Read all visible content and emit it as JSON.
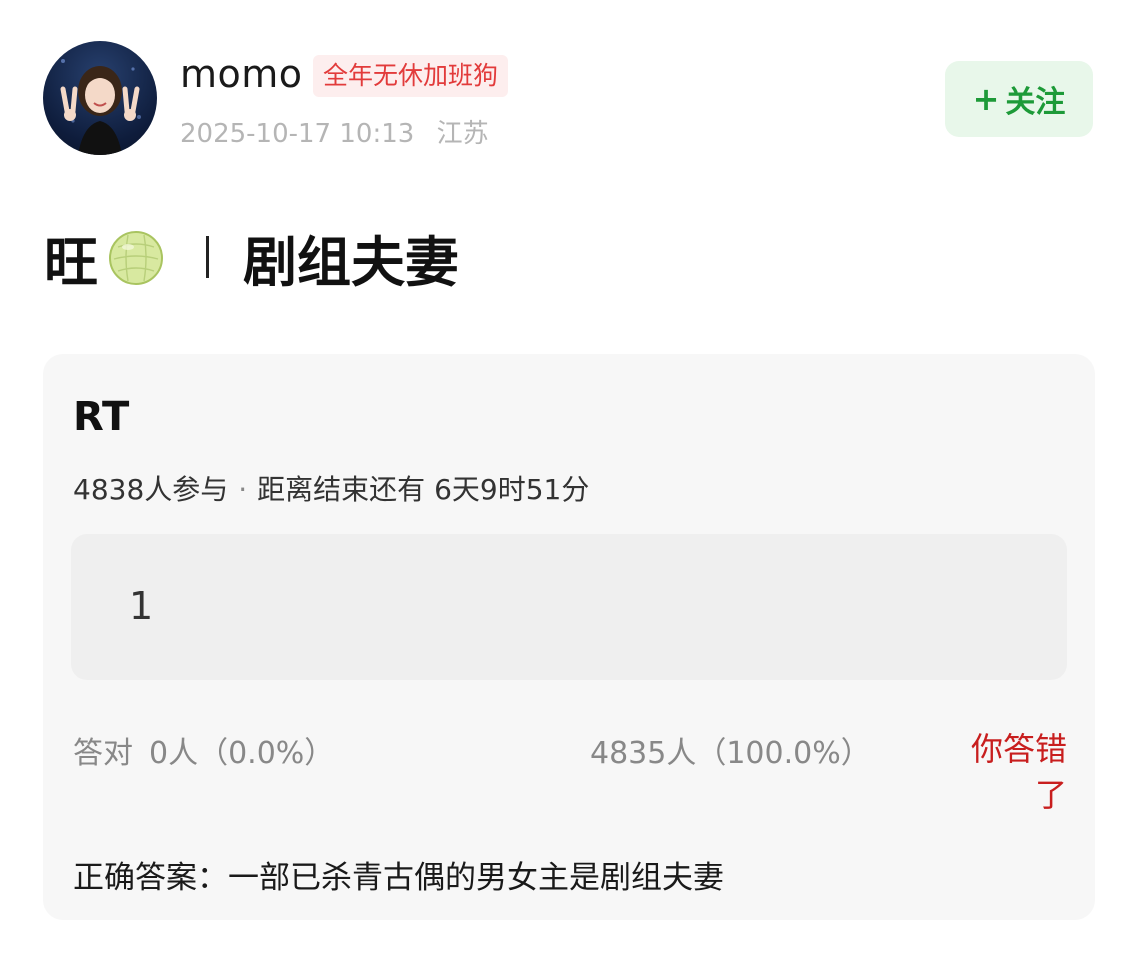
{
  "post": {
    "author": {
      "name": "momo",
      "badge": "全年无休加班狗",
      "timestamp": "2025-10-17 10:13",
      "location": "江苏"
    },
    "follow_button": {
      "icon": "plus-icon",
      "label": "关注"
    },
    "title": {
      "prefix": "旺",
      "emoji": "melon-icon",
      "main": "剧组夫妻"
    }
  },
  "quiz": {
    "question": "RT",
    "participants": "4838人参与",
    "separator": "·",
    "deadline": "距离结束还有 6天9时51分",
    "options": [
      {
        "label": "1"
      }
    ],
    "correct_label": "答对",
    "correct_stat": "0人（0.0%）",
    "wrong_stat": "4835人（100.0%）",
    "result": "你答错了",
    "answer": "正确答案：一部已杀青古偶的男女主是剧组夫妻"
  },
  "colors": {
    "badge_text": "#e23b3b",
    "badge_bg": "#fdeeee",
    "follow_text": "#1d9a38",
    "follow_bg": "#e8f7ea",
    "wrong_text": "#c81e1e",
    "card_bg": "#f7f7f7"
  }
}
